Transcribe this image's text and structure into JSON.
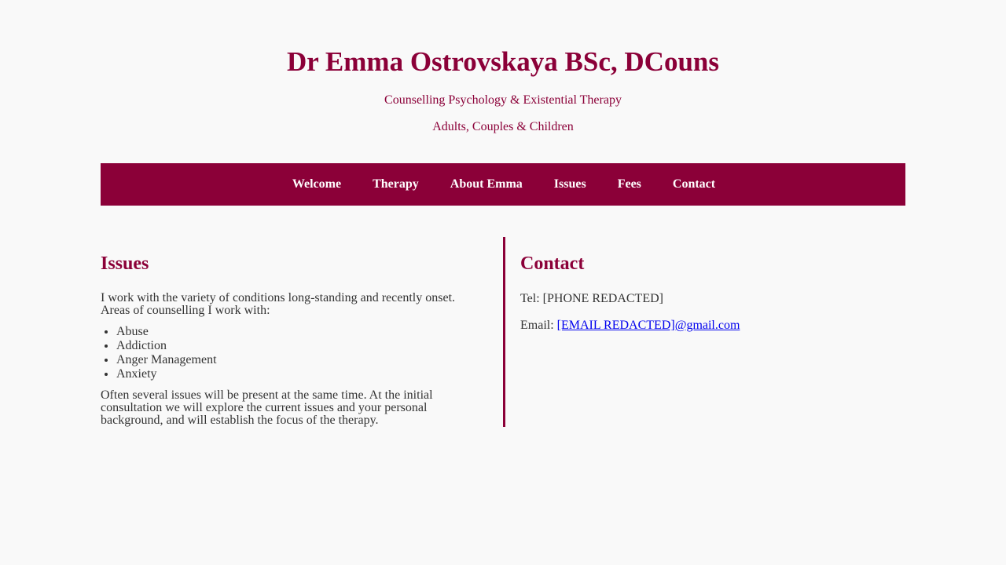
{
  "header": {
    "title": "Dr Emma Ostrovskaya BSc, DCouns",
    "subtitle1": "Counselling Psychology & Existential Therapy",
    "subtitle2": "Adults, Couples & Children"
  },
  "nav": {
    "items": [
      "Welcome",
      "Therapy",
      "About Emma",
      "Issues",
      "Fees",
      "Contact"
    ]
  },
  "issues": {
    "heading": "Issues",
    "intro": "I work with the variety of conditions long-standing and recently onset. Areas of counselling I work with:",
    "list": [
      "Abuse",
      "Addiction",
      "Anger Management",
      "Anxiety"
    ],
    "outro": "Often several issues will be present at the same time. At the initial consultation we will explore the current issues and your personal background, and will establish the focus of the therapy."
  },
  "contact": {
    "heading": "Contact",
    "tel_label": "Tel: ",
    "tel_value": "[PHONE REDACTED]",
    "email_label": "Email: ",
    "email_value": "[EMAIL REDACTED]@gmail.com"
  },
  "colors": {
    "accent": "#8b0038",
    "text": "#333333",
    "background": "#f9f9f9",
    "link": "#0000ee"
  }
}
